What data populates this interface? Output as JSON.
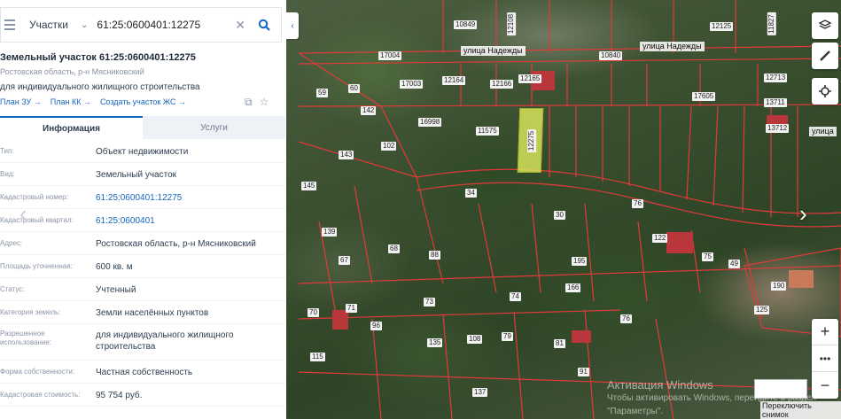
{
  "search": {
    "category": "Участки",
    "value": "61:25:0600401:12275"
  },
  "object": {
    "title": "Земельный участок 61:25:0600401:12275",
    "region": "Ростовская область, р-н Мясниковский",
    "purpose": "для индивидуального жилищного строительства",
    "links": [
      "План ЗУ →",
      "План КК →",
      "Создать участок ЖС →"
    ]
  },
  "tabs": [
    "Информация",
    "Услуги"
  ],
  "info_rows": [
    {
      "key": "Тип:",
      "value": "Объект недвижимости",
      "link": false
    },
    {
      "key": "Вид:",
      "value": "Земельный участок",
      "link": false
    },
    {
      "key": "Кадастровый номер:",
      "value": "61:25:0600401:12275",
      "link": true
    },
    {
      "key": "Кадастровый квартал:",
      "value": "61:25:0600401",
      "link": true
    },
    {
      "key": "Адрес:",
      "value": "Ростовская область, р-н Мясниковский",
      "link": false
    },
    {
      "key": "Площадь уточненная:",
      "value": "600 кв. м",
      "link": false
    },
    {
      "key": "Статус:",
      "value": "Учтенный",
      "link": false
    },
    {
      "key": "Категория земель:",
      "value": "Земли населённых пунктов",
      "link": false
    },
    {
      "key": "Разрешенное использование:",
      "value": "для индивидуального жилищного строительства",
      "link": false
    },
    {
      "key": "Форма собственности:",
      "value": "Частная собственность",
      "link": false
    },
    {
      "key": "Кадастровая стоимость:",
      "value": "95 754 руб.",
      "link": false
    }
  ],
  "map": {
    "streets": [
      "улица Надежды",
      "улица Надежды",
      "улица"
    ],
    "plot_labels": [
      "10849",
      "12108",
      "12125",
      "11827",
      "17004",
      "10840",
      "17003",
      "12164",
      "12166",
      "12165",
      "17605",
      "12713",
      "16998",
      "11575",
      "12275",
      "13711",
      "13712",
      "142",
      "59",
      "60",
      "143",
      "102",
      "145",
      "34",
      "76",
      "30",
      "139",
      "122",
      "75",
      "49",
      "67",
      "68",
      "88",
      "195",
      "190",
      "125",
      "166",
      "70",
      "71",
      "73",
      "74",
      "76",
      "96",
      "135",
      "108",
      "79",
      "81",
      "115",
      "137",
      "91"
    ],
    "watermark_title": "Активация Windows",
    "watermark_sub": "Чтобы активировать Windows, перейдите в раздел \"Параметры\".",
    "switch_label": "Переключить снимок"
  }
}
